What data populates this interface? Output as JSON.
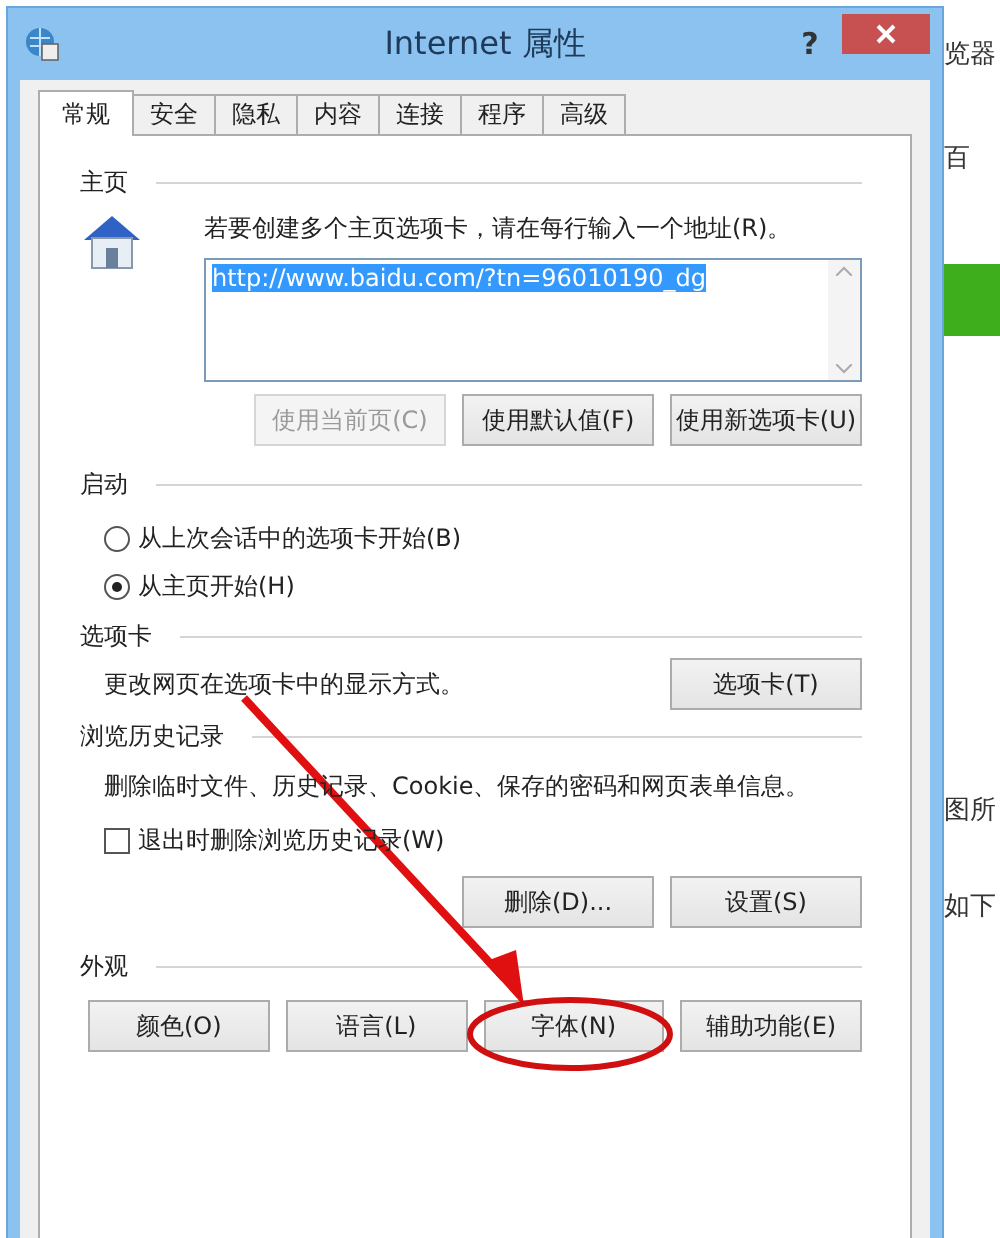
{
  "window": {
    "title": "Internet 属性",
    "help": "?"
  },
  "tabs": [
    {
      "label": "常规",
      "selected": true
    },
    {
      "label": "安全",
      "selected": false
    },
    {
      "label": "隐私",
      "selected": false
    },
    {
      "label": "内容",
      "selected": false
    },
    {
      "label": "连接",
      "selected": false
    },
    {
      "label": "程序",
      "selected": false
    },
    {
      "label": "高级",
      "selected": false
    }
  ],
  "homepage": {
    "label": "主页",
    "hint": "若要创建多个主页选项卡，请在每行输入一个地址(R)。",
    "url": {
      "value": "http://www.baidu.com/?tn=96010190_dg",
      "selected": true
    },
    "buttons": [
      {
        "label": "使用当前页(C)",
        "disabled": true
      },
      {
        "label": "使用默认值(F)",
        "disabled": false
      },
      {
        "label": "使用新选项卡(U)",
        "disabled": false
      }
    ]
  },
  "startup": {
    "label": "启动",
    "options": [
      {
        "label": "从上次会话中的选项卡开始(B)",
        "selected": false
      },
      {
        "label": "从主页开始(H)",
        "selected": true
      }
    ]
  },
  "tabs_section": {
    "label": "选项卡",
    "description": "更改网页在选项卡中的显示方式。",
    "button": "选项卡(T)"
  },
  "history": {
    "label": "浏览历史记录",
    "description": "删除临时文件、历史记录、Cookie、保存的密码和网页表单信息。",
    "checkbox": {
      "label": "退出时删除浏览历史记录(W)",
      "checked": false
    },
    "buttons": [
      "删除(D)...",
      "设置(S)"
    ]
  },
  "appearance": {
    "label": "外观",
    "buttons": [
      "颜色(O)",
      "语言(L)",
      "字体(N)",
      "辅助功能(E)"
    ]
  },
  "background": {
    "fragments": [
      "览器",
      "百",
      "图所",
      "如下"
    ]
  }
}
